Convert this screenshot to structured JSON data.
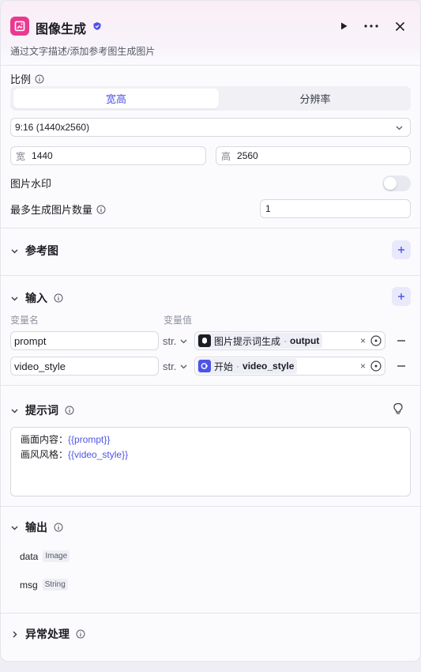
{
  "header": {
    "title": "图像生成",
    "subtitle": "通过文字描述/添加参考图生成图片",
    "icons": [
      "image-gen-icon",
      "verified-badge-icon",
      "play-icon",
      "more-icon",
      "close-icon"
    ],
    "accent_color": "#e93a8f"
  },
  "ratio": {
    "label": "比例",
    "tabs": [
      "宽高",
      "分辨率"
    ],
    "selected_tab": "宽高",
    "select_value": "9:16 (1440x2560)",
    "width_prefix": "宽",
    "width_value": "1440",
    "height_prefix": "高",
    "height_value": "2560"
  },
  "watermark": {
    "label": "图片水印",
    "enabled": false
  },
  "max_images": {
    "label": "最多生成图片数量",
    "value": "1"
  },
  "reference": {
    "title": "参考图"
  },
  "inputs": {
    "title": "输入",
    "col_name": "变量名",
    "col_value": "变量值",
    "rows": [
      {
        "name": "prompt",
        "type": "str.",
        "ref_node": "图片提示词生成",
        "sep": "·",
        "ref_field": "output",
        "ref_icon": "llm-node-icon",
        "icon_color": "#1c1d23"
      },
      {
        "name": "video_style",
        "type": "str.",
        "ref_node": "开始",
        "sep": "·",
        "ref_field": "video_style",
        "ref_icon": "start-node-icon",
        "icon_color": "#4d53e8"
      }
    ]
  },
  "prompt_section": {
    "title": "提示词",
    "line1_label": "画面内容：",
    "line1_var": "{{prompt}}",
    "line2_label": "画风风格：",
    "line2_var": "{{video_style}}"
  },
  "outputs": {
    "title": "输出",
    "items": [
      {
        "name": "data",
        "type": "Image"
      },
      {
        "name": "msg",
        "type": "String"
      }
    ]
  },
  "exception": {
    "title": "异常处理"
  }
}
